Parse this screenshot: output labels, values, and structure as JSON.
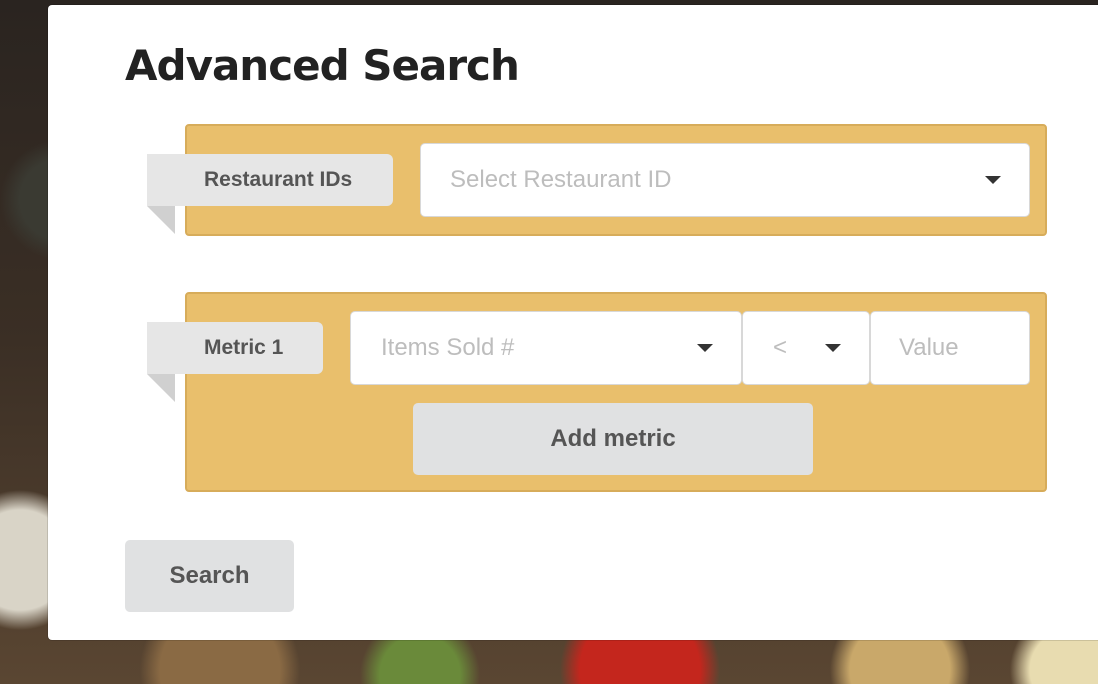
{
  "modal": {
    "title": "Advanced Search"
  },
  "restaurant_filter": {
    "label": "Restaurant IDs",
    "select_placeholder": "Select Restaurant ID"
  },
  "metric_filter": {
    "label": "Metric 1",
    "metric_placeholder": "Items Sold #",
    "operator_value": "<",
    "value_placeholder": "Value",
    "add_metric_label": "Add metric"
  },
  "actions": {
    "search_label": "Search"
  },
  "colors": {
    "segment_background": "#e9bf6c",
    "label_background": "#e6e6e6",
    "button_background": "#e0e1e2"
  }
}
